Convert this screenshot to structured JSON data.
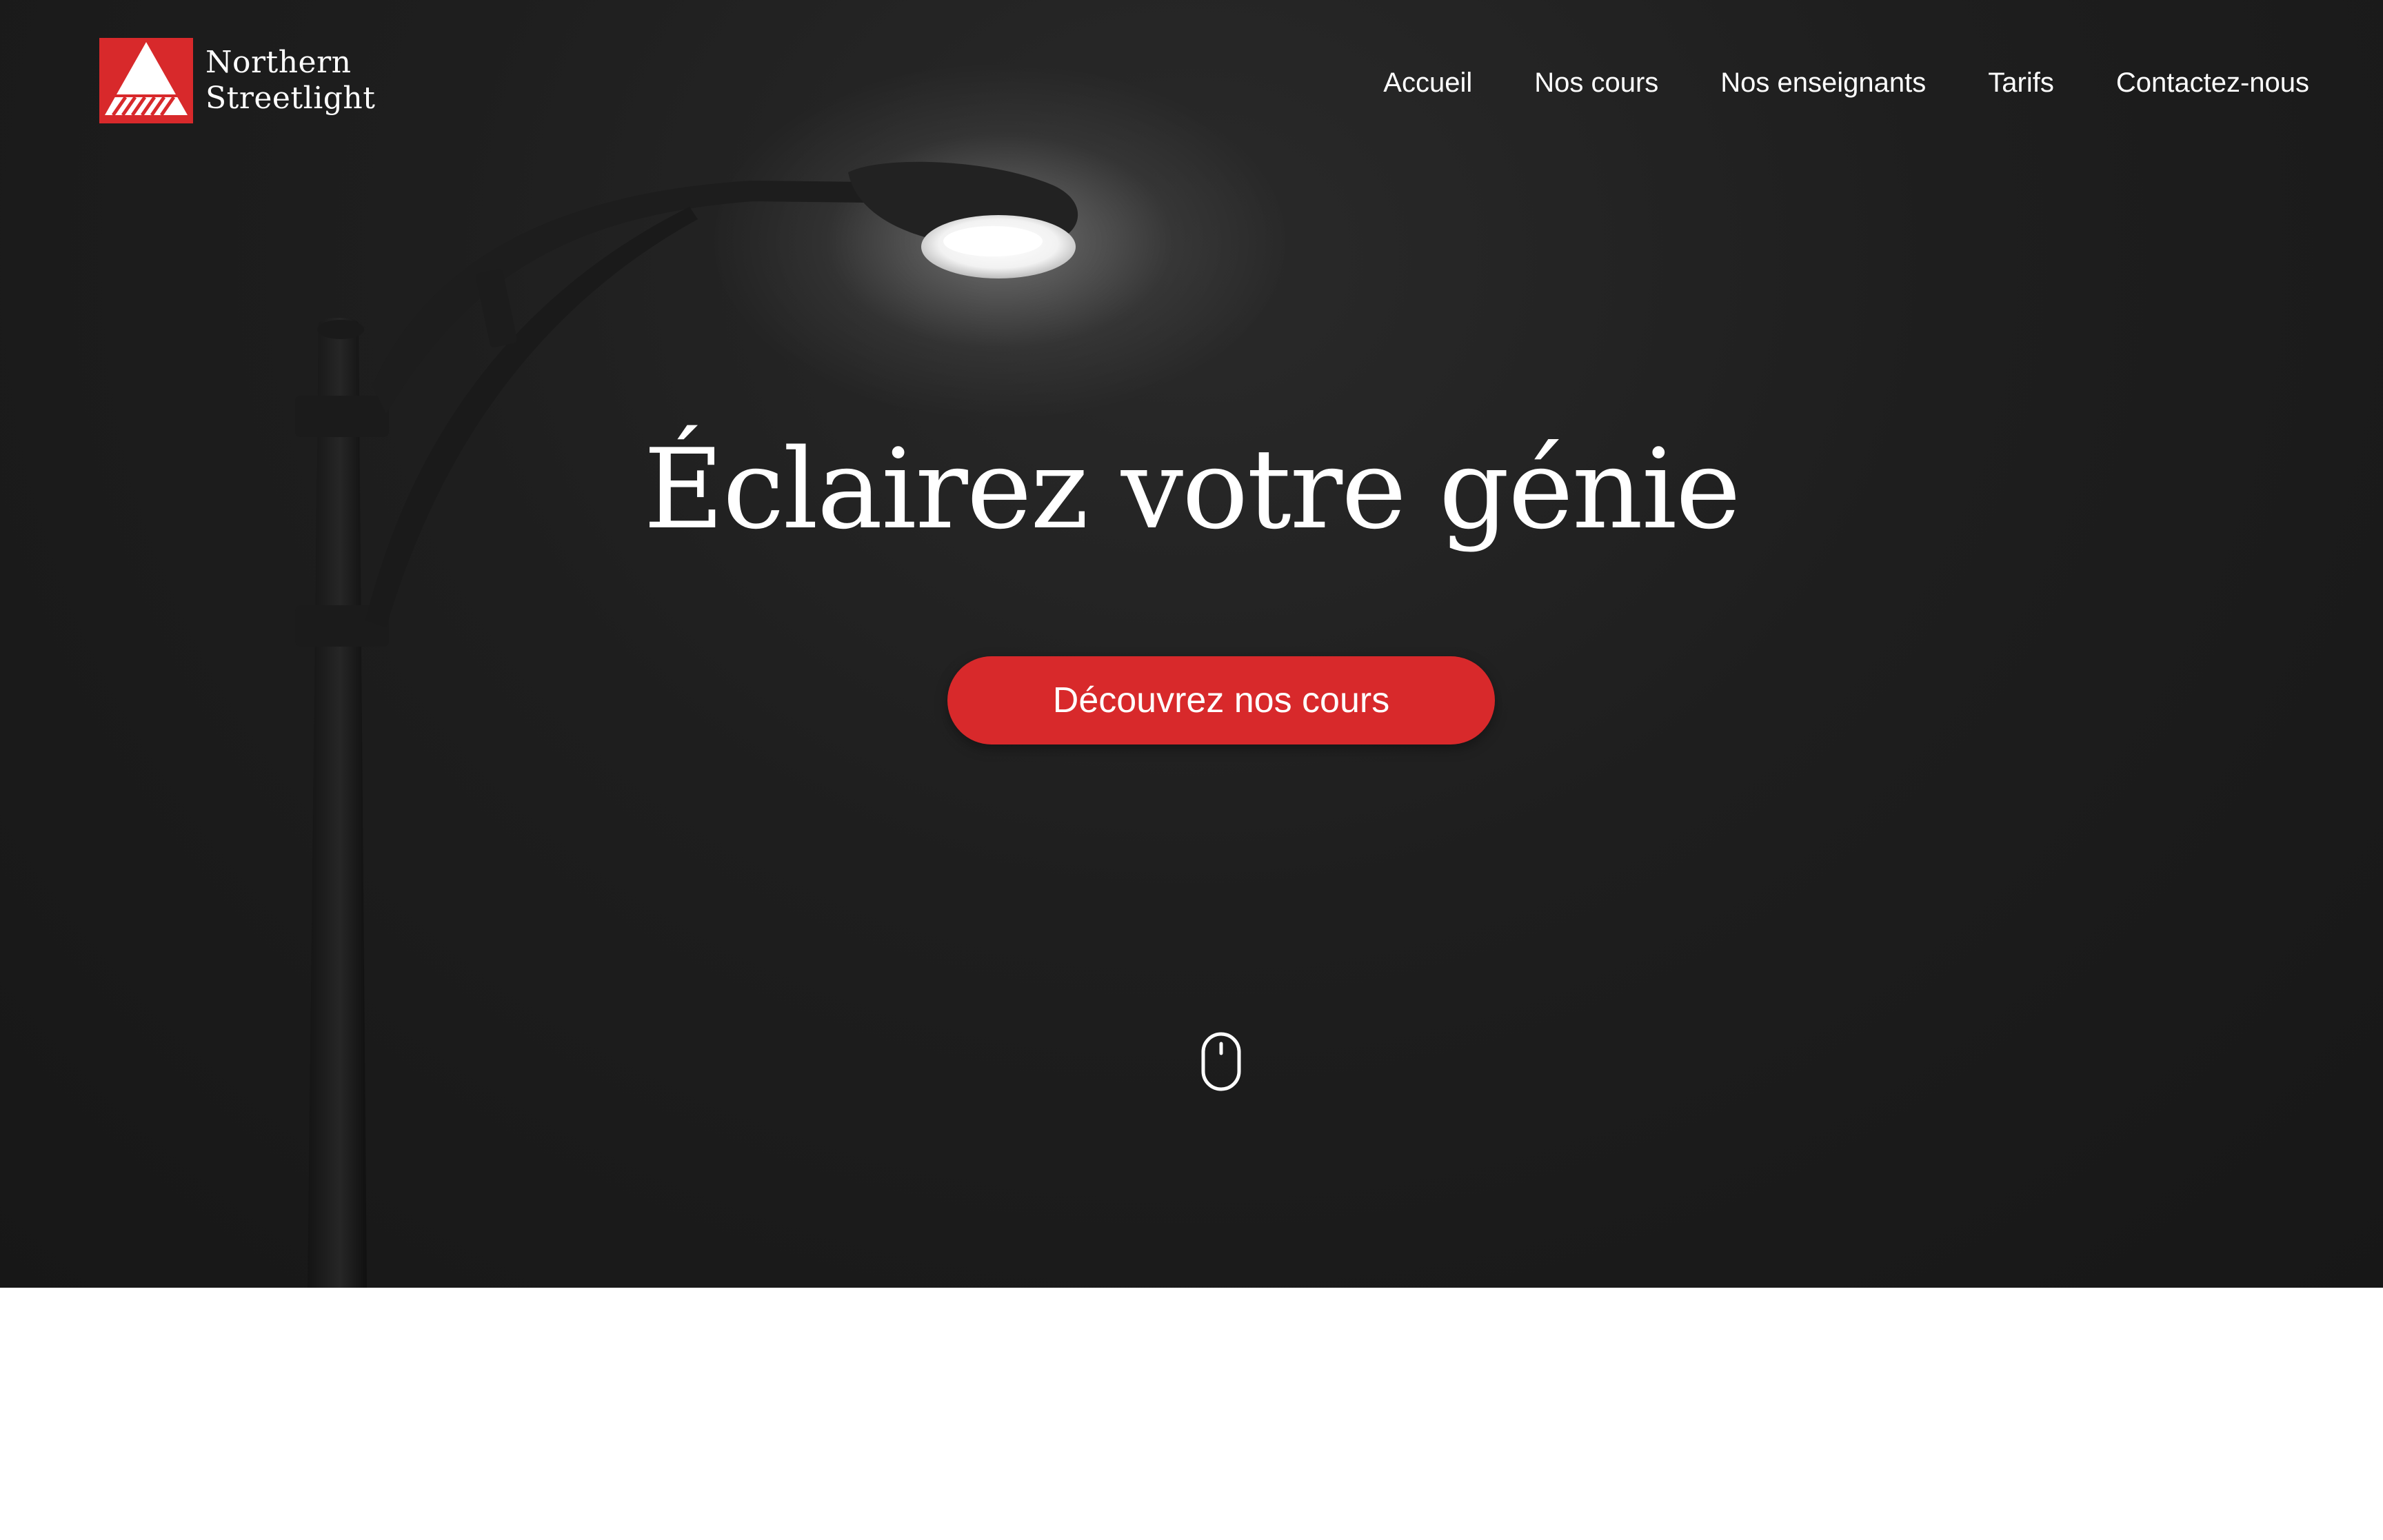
{
  "brand": {
    "name_line1": "Northern",
    "name_line2": "Streetlight",
    "accent_color": "#d8292b",
    "logo_icon": "mountain-triangle-icon"
  },
  "nav": {
    "items": [
      {
        "label": "Accueil"
      },
      {
        "label": "Nos cours"
      },
      {
        "label": "Nos enseignants"
      },
      {
        "label": "Tarifs"
      },
      {
        "label": "Contactez-nous"
      }
    ]
  },
  "hero": {
    "title": "Éclairez votre génie",
    "cta_label": "Découvrez nos cours",
    "background_subject": "street-lamp-photo",
    "scroll_icon": "mouse-scroll-icon",
    "colors": {
      "background": "#1e1e1e",
      "text": "#ffffff",
      "button": "#d8292b"
    }
  }
}
